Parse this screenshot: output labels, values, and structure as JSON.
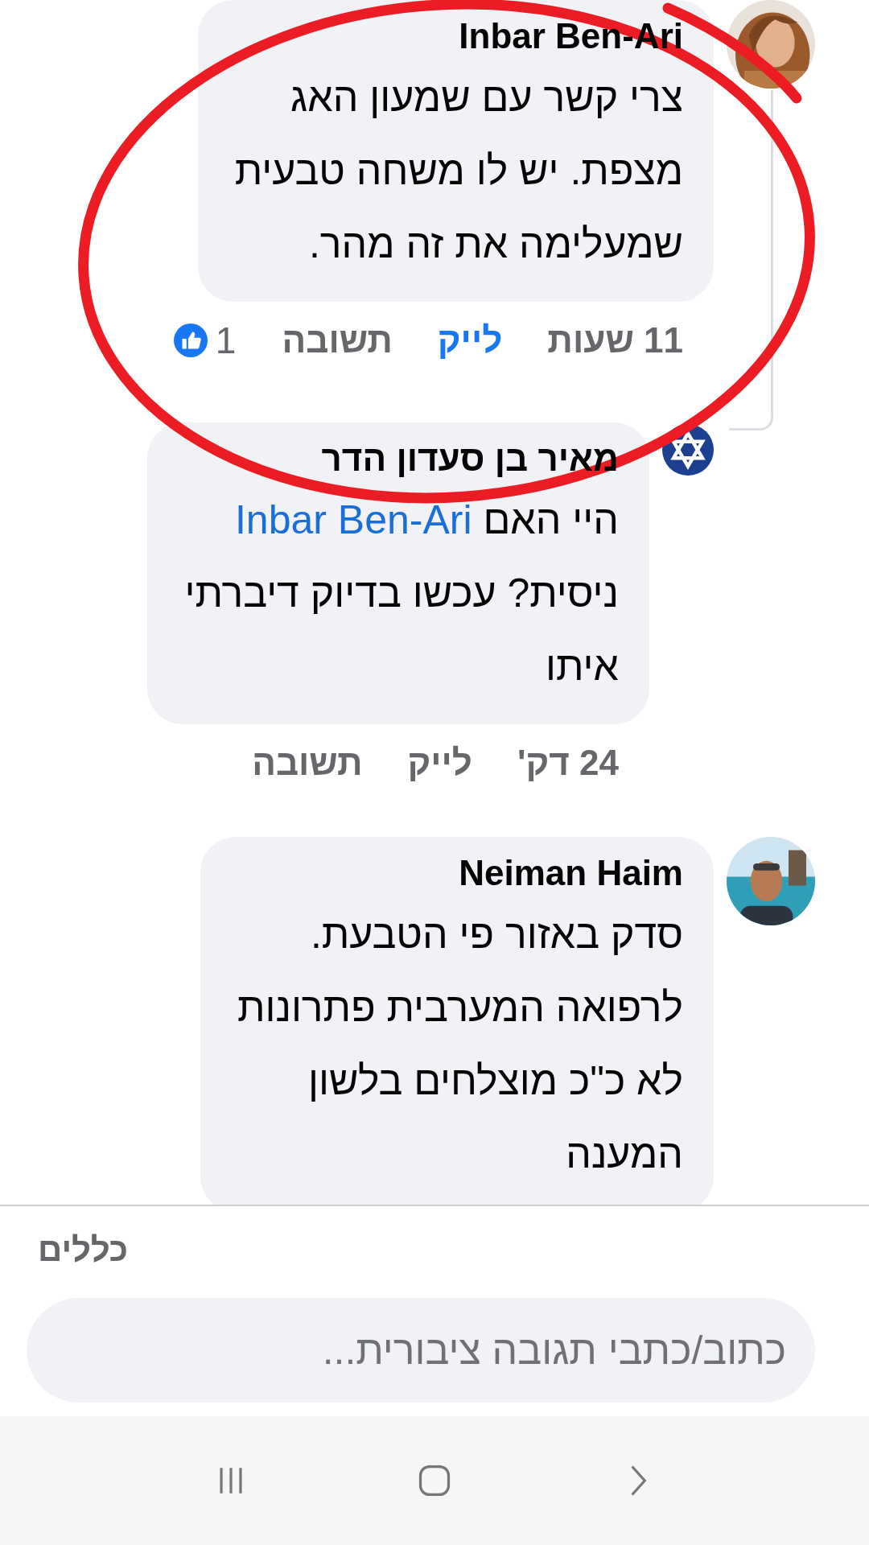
{
  "comments": [
    {
      "author": "Inbar Ben-Ari",
      "is_reply": false,
      "text": "צרי קשר עם שמעון האג\nמצפת. יש לו משחה טבעית\nשמעלימה את זה מהר.",
      "time": "11 שעות",
      "like": "לייק",
      "liked": true,
      "reply": "תשובה",
      "reaction_count": "1"
    },
    {
      "author": "מאיר בן סעדון הדר",
      "avatar": {
        "kind": "emblem"
      },
      "is_reply": true,
      "text_start": "היי האם",
      "mention": "Inbar Ben-Ari",
      "text": "ניסית? עכשו בדיוק דיברתי\nאיתו",
      "time": "24 דק'",
      "like": "לייק",
      "liked": false,
      "reply": "תשובה"
    },
    {
      "author": "Neiman Haim",
      "is_reply": false,
      "text": "סדק באזור פי הטבעת.\nלרפואה המערבית פתרונות\nלא כ\"כ מוצלחים בלשון\nהמענה"
    }
  ],
  "highlight_mark": {
    "kind": "ellipse"
  },
  "rules_link": "כללים",
  "reply_field": {
    "placeholder": "כתוב/כתבי תגובה ציבורית..."
  }
}
